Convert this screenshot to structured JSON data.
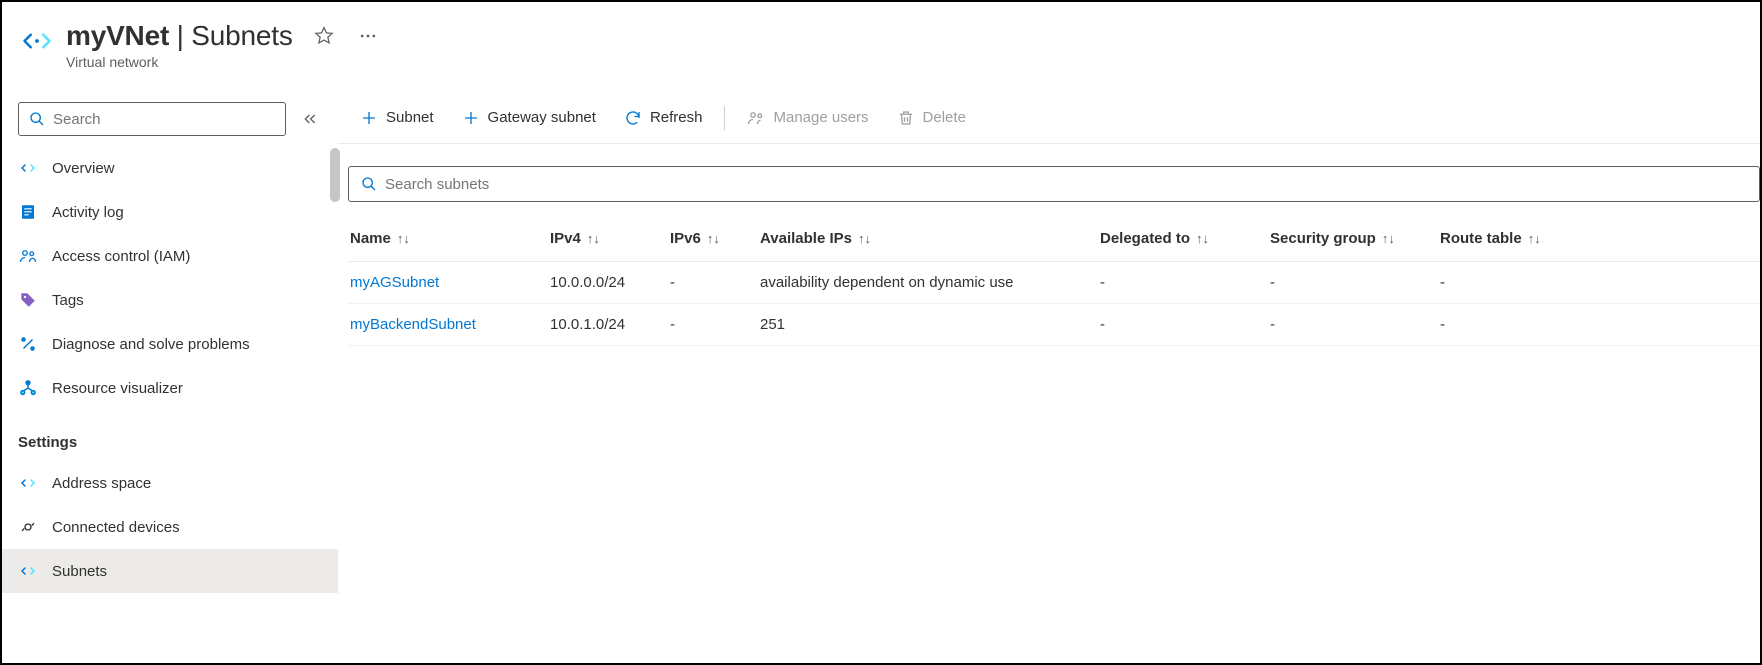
{
  "header": {
    "resource_name": "myVNet",
    "section": "Subnets",
    "subtitle": "Virtual network"
  },
  "sidebar": {
    "search_placeholder": "Search",
    "groups": [
      {
        "items": [
          {
            "key": "overview",
            "label": "Overview"
          },
          {
            "key": "activity-log",
            "label": "Activity log"
          },
          {
            "key": "access-control",
            "label": "Access control (IAM)"
          },
          {
            "key": "tags",
            "label": "Tags"
          },
          {
            "key": "diagnose",
            "label": "Diagnose and solve problems"
          },
          {
            "key": "resource-visualizer",
            "label": "Resource visualizer"
          }
        ]
      },
      {
        "title": "Settings",
        "items": [
          {
            "key": "address-space",
            "label": "Address space"
          },
          {
            "key": "connected-devices",
            "label": "Connected devices"
          },
          {
            "key": "subnets",
            "label": "Subnets",
            "selected": true
          }
        ]
      }
    ]
  },
  "toolbar": {
    "subnet": "Subnet",
    "gateway_subnet": "Gateway subnet",
    "refresh": "Refresh",
    "manage_users": "Manage users",
    "delete": "Delete"
  },
  "subnet_search_placeholder": "Search subnets",
  "table": {
    "columns": {
      "name": "Name",
      "ipv4": "IPv4",
      "ipv6": "IPv6",
      "available_ips": "Available IPs",
      "delegated_to": "Delegated to",
      "security_group": "Security group",
      "route_table": "Route table"
    },
    "rows": [
      {
        "name": "myAGSubnet",
        "ipv4": "10.0.0.0/24",
        "ipv6": "-",
        "available_ips": "availability dependent on dynamic use",
        "delegated_to": "-",
        "security_group": "-",
        "route_table": "-"
      },
      {
        "name": "myBackendSubnet",
        "ipv4": "10.0.1.0/24",
        "ipv6": "-",
        "available_ips": "251",
        "delegated_to": "-",
        "security_group": "-",
        "route_table": "-"
      }
    ]
  }
}
